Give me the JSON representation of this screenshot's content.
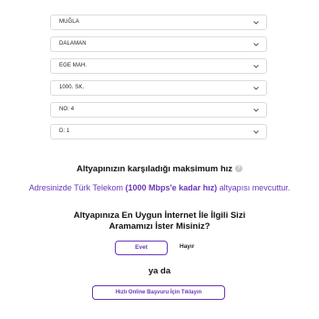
{
  "address_selects": [
    {
      "value": "MUĞLA"
    },
    {
      "value": "DALAMAN"
    },
    {
      "value": "EGE MAH."
    },
    {
      "value": "1000. SK."
    },
    {
      "value": "NO: 4"
    },
    {
      "value": "D: 1"
    }
  ],
  "speed": {
    "title": "Altyapınızın karşıladığı maksimum hız",
    "help_icon": "question-icon",
    "availability_prefix": "Adresinizde Türk Telekom ",
    "availability_highlight": "(1000 Mbps'e kadar hız)",
    "availability_suffix": " altyapısı mevcuttur."
  },
  "callback": {
    "question_line1": "Altyapınıza En Uygun İnternet İle İlgili Sizi",
    "question_line2": "Aramamızı İster Misiniz?",
    "yes_label": "Evet",
    "no_label": "Hayır",
    "or_label": "ya da",
    "apply_label": "Hızlı Online Başvuru İçin Tıklayın"
  },
  "colors": {
    "accent": "#6a36b8",
    "border": "#dcdcdc"
  }
}
